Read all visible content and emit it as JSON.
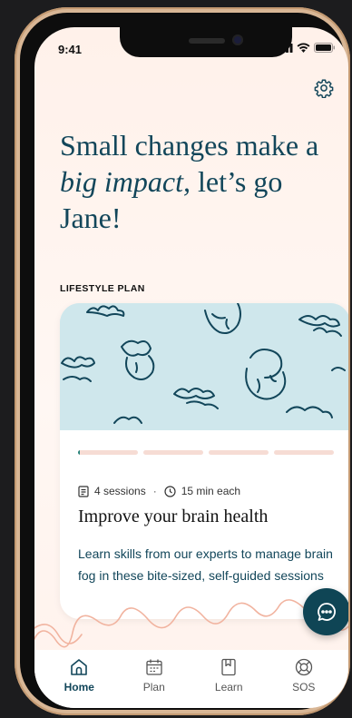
{
  "status_bar": {
    "time": "9:41"
  },
  "header": {
    "title_part1": "Small changes make a",
    "title_italic": "big impact,",
    "title_part2": " let’s go Jane!"
  },
  "section": {
    "label": "LIFESTYLE PLAN"
  },
  "plan_card": {
    "progress_fraction": 0.0,
    "segments": 4,
    "sessions": "4 sessions",
    "separator": "·",
    "duration": "15 min each",
    "title": "Improve your brain health",
    "description": "Learn skills from our experts to manage brain fog in these bite-sized, self-guided sessions"
  },
  "tabbar": {
    "items": [
      {
        "label": "Home",
        "icon": "home-icon",
        "active": true
      },
      {
        "label": "Plan",
        "icon": "calendar-icon",
        "active": false
      },
      {
        "label": "Learn",
        "icon": "bookmark-book-icon",
        "active": false
      },
      {
        "label": "SOS",
        "icon": "lifebuoy-icon",
        "active": false
      }
    ]
  },
  "colors": {
    "accent": "#12465a",
    "progress_fill": "#23827a",
    "card_illustration_bg": "#cfe7ec",
    "squiggle": "#f1b39f",
    "fab": "#0f4555"
  }
}
